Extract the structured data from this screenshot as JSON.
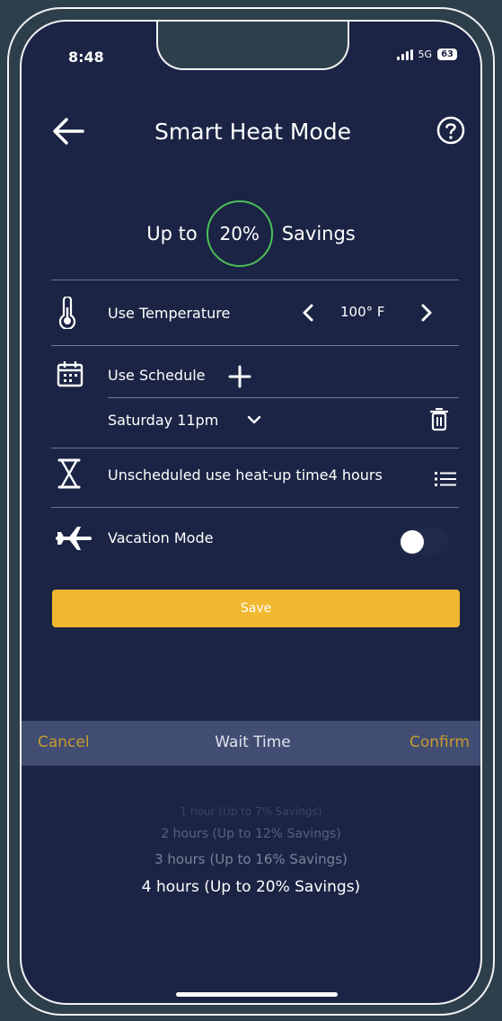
{
  "status_bar": {
    "time": "8:48",
    "network": "5G",
    "battery": "63"
  },
  "header": {
    "title": "Smart Heat Mode",
    "back_icon": "arrow-left-icon",
    "help_icon": "question-circle-icon"
  },
  "savings": {
    "prefix": "Up to",
    "percent": "20%",
    "suffix": "Savings",
    "ring_color": "#4cbf5a"
  },
  "temperature": {
    "icon": "thermometer-icon",
    "label": "Use Temperature",
    "value": "100° F"
  },
  "schedule": {
    "icon": "calendar-icon",
    "label": "Use Schedule",
    "entry": "Saturday 11pm",
    "delete_icon": "trash-icon"
  },
  "unscheduled": {
    "icon": "hourglass-icon",
    "label": "Unscheduled use heat-up time",
    "value": "4 hours",
    "list_icon": "list-icon"
  },
  "vacation": {
    "icon": "airplane-icon",
    "label": "Vacation Mode",
    "enabled": false
  },
  "save_button": {
    "label": "Save",
    "color": "#f2b830"
  },
  "picker": {
    "cancel": "Cancel",
    "title": "Wait Time",
    "confirm": "Confirm",
    "options": [
      "1 hour (Up to 7% Savings)",
      "2 hours (Up to 12% Savings)",
      "3 hours (Up to 16% Savings)",
      "4 hours (Up to 20% Savings)"
    ],
    "selected_index": 3
  },
  "colors": {
    "background": "#1b2444",
    "accent": "#f2b830",
    "picker_action": "#c79b2b"
  }
}
